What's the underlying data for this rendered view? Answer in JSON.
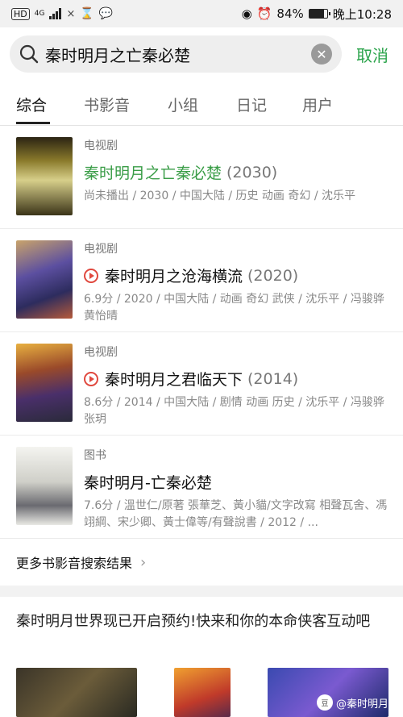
{
  "status": {
    "network_badge": "HD",
    "network_type": "4G",
    "battery_percent": "84%",
    "battery_level": 0.84,
    "time": "晚上10:28"
  },
  "search": {
    "query": "秦时明月之亡秦必楚",
    "cancel_label": "取消"
  },
  "tabs": [
    "综合",
    "书影音",
    "小组",
    "日记",
    "用户"
  ],
  "results": [
    {
      "category": "电视剧",
      "title": "秦时明月之亡秦必楚",
      "year": "(2030)",
      "desc": "尚未播出 / 2030 / 中国大陆 / 历史 动画 奇幻 / 沈乐平"
    },
    {
      "category": "电视剧",
      "title": "秦时明月之沧海横流",
      "year": "(2020)",
      "desc": "6.9分 / 2020 / 中国大陆 / 动画 奇幻 武侠 / 沈乐平 / 冯骏骅 黄怡晴"
    },
    {
      "category": "电视剧",
      "title": "秦时明月之君临天下",
      "year": "(2014)",
      "desc": "8.6分 / 2014 / 中国大陆 / 剧情 动画 历史 / 沈乐平 / 冯骏骅 张玥"
    },
    {
      "category": "图书",
      "title": "秦时明月-亡秦必楚",
      "year": "",
      "desc": "7.6分 / 溫世仁/原著 張華芝、黃小貓/文字改寫 相聲瓦舍、馮翊綱、宋少卿、黃士偉等/有聲說書 / 2012 / ..."
    }
  ],
  "more_label": "更多书影音搜索结果",
  "promo_text": "秦时明月世界现已开启预约!快来和你的本命侠客互动吧",
  "watermark": "@秦时明月",
  "watermark_logo": "豆",
  "colors": {
    "accent_green": "#2aa34a",
    "play_red": "#e0483e"
  }
}
